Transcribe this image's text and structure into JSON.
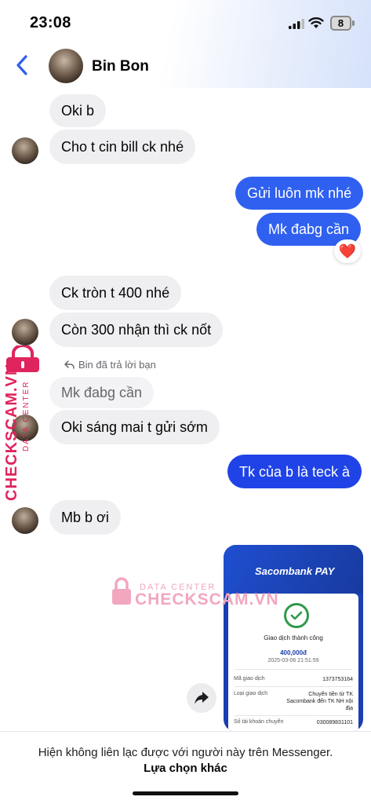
{
  "status_bar": {
    "time": "23:08",
    "battery": "8"
  },
  "header": {
    "contact_name": "Bin Bon"
  },
  "messages": [
    {
      "text": "Oki b"
    },
    {
      "text": "Cho t cin bill ck nhé"
    },
    {
      "text": "Gửi luôn mk nhé"
    },
    {
      "text": "Mk đabg cần",
      "reaction": "❤️"
    },
    {
      "text": "Ck tròn t 400 nhé"
    },
    {
      "text": "Còn 300 nhận thì ck nốt"
    },
    {
      "text": "Mk đabg cần"
    },
    {
      "text": "Oki sáng mai t gửi sớm"
    },
    {
      "text": "Tk của b là teck à"
    },
    {
      "text": "Mb b ơi"
    }
  ],
  "reply_note": "Bin đã trả lời bạn",
  "watermark": {
    "sub": "DATA CENTER",
    "main": "CHECKSCAM.VN",
    "main2": "CHECKSCAM.VN"
  },
  "receipt": {
    "brand": "Sacombank PAY",
    "title": "Giao dịch thành công",
    "amount": "400,000đ",
    "datetime": "2025-03-06 21:51:59",
    "rows": [
      {
        "label": "Mã giao dịch",
        "value": "1373753164"
      },
      {
        "label": "Loại giao dịch",
        "value": "Chuyển tiền từ TK Sacombank đến TK NH nội địa"
      },
      {
        "label": "Số tài khoản chuyển",
        "value": "030089831101"
      }
    ]
  },
  "footer": {
    "message": "Hiện không liên lạc được với người này trên Messenger.",
    "link": "Lựa chọn khác"
  }
}
